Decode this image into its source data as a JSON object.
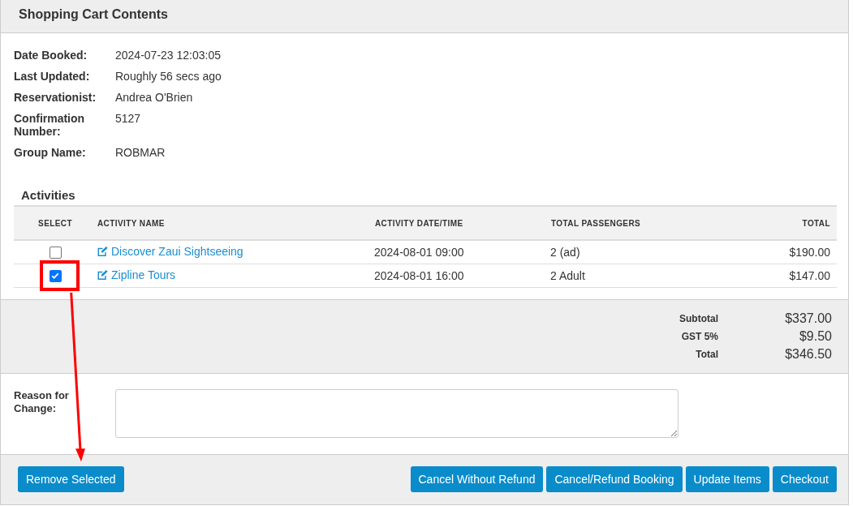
{
  "panel": {
    "title": "Shopping Cart Contents"
  },
  "details": [
    {
      "label": "Date Booked:",
      "value": "2024-07-23 12:03:05"
    },
    {
      "label": "Last Updated:",
      "value": "Roughly 56 secs ago"
    },
    {
      "label": "Reservationist:",
      "value": "Andrea O'Brien"
    },
    {
      "label": "Confirmation Number:",
      "value": "5127"
    },
    {
      "label": "Group Name:",
      "value": "ROBMAR"
    }
  ],
  "activities": {
    "title": "Activities",
    "columns": [
      "SELECT",
      "ACTIVITY NAME",
      "ACTIVITY DATE/TIME",
      "TOTAL PASSENGERS",
      "TOTAL"
    ],
    "rows": [
      {
        "checked": false,
        "highlighted": false,
        "name": "Discover Zaui Sightseeing",
        "datetime": "2024-08-01 09:00",
        "passengers": "2 (ad)",
        "total": "$190.00"
      },
      {
        "checked": true,
        "highlighted": true,
        "name": "Zipline Tours",
        "datetime": "2024-08-01 16:00",
        "passengers": "2 Adult",
        "total": "$147.00"
      }
    ]
  },
  "totals": [
    {
      "label": "Subtotal",
      "value": "$337.00"
    },
    {
      "label": "GST 5%",
      "value": "$9.50"
    },
    {
      "label": "Total",
      "value": "$346.50"
    }
  ],
  "reason": {
    "label": "Reason for Change:"
  },
  "buttons_left": [
    "Remove Selected"
  ],
  "buttons_right": [
    "Cancel Without Refund",
    "Cancel/Refund Booking",
    "Update Items",
    "Checkout"
  ]
}
